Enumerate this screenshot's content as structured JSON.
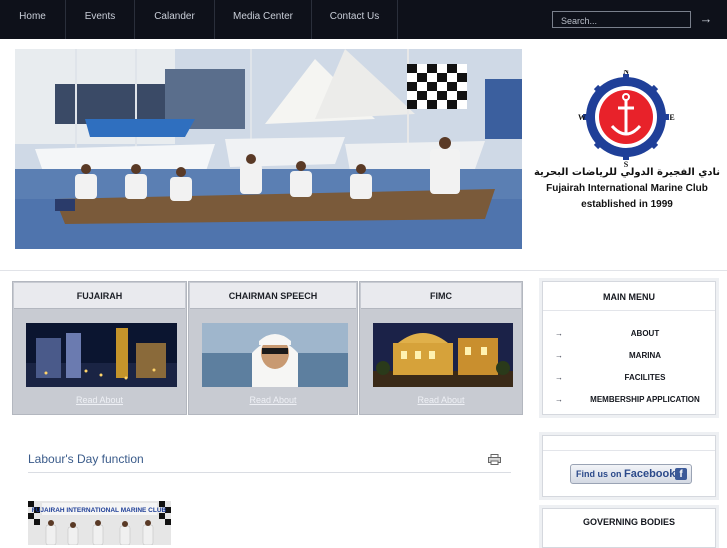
{
  "nav": {
    "items": [
      "Home",
      "Events",
      "Calander",
      "Media Center",
      "Contact Us"
    ],
    "search_placeholder": "Search...",
    "search_icon": "arrow-right-icon"
  },
  "header": {
    "logo_arabic": "نادي الفجيرة الدولي للرياضات البحرية",
    "logo_english": "Fujairah International Marine Club",
    "logo_established": "established in 1999",
    "compass_letters": {
      "n": "N",
      "s": "S",
      "e": "E",
      "w": "W"
    }
  },
  "features": [
    {
      "title": "FUJAIRAH",
      "link": "Read About"
    },
    {
      "title": "CHAIRMAN SPEECH",
      "link": "Read About"
    },
    {
      "title": "FIMC",
      "link": "Read About"
    }
  ],
  "article": {
    "title": "Labour's Day function",
    "print_icon": "printer-icon",
    "photo_banner_text": "FUJAIRAH INTERNATIONAL MARINE CLUB"
  },
  "sidebar": {
    "main_menu": {
      "title": "MAIN MENU",
      "items": [
        "ABOUT",
        "MARINA",
        "FACILITES",
        "MEMBERSHIP APPLICATION"
      ]
    },
    "facebook": {
      "prefix": "Find us on",
      "brand": "Facebook",
      "logo_letter": "f"
    },
    "governing": {
      "title": "GOVERNING BODIES"
    }
  },
  "colors": {
    "nav_bg": "#0e111a",
    "link_blue": "#3a5b8a",
    "facebook_blue": "#3b5998",
    "box_gray": "#c8cbd2"
  }
}
